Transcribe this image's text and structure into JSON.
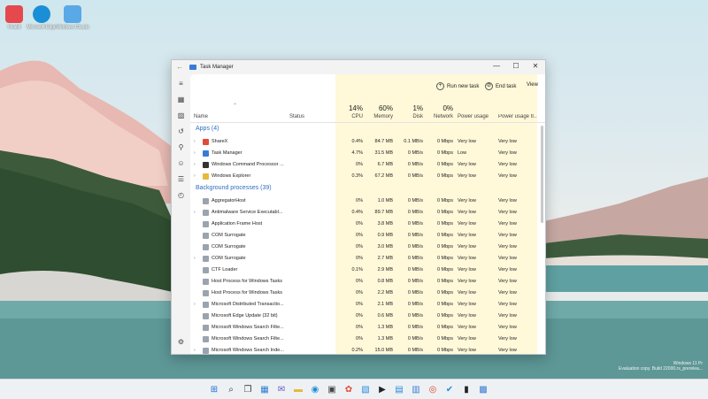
{
  "desktop_icons": [
    {
      "label": "Vivaldi",
      "color": "#e5484d"
    },
    {
      "label": "Microsoft Edge",
      "color": "#1b8fd6"
    },
    {
      "label": "Windows Clouds",
      "color": "#5aa9e6"
    }
  ],
  "watermark": {
    "line1": "Windows 11 Pr",
    "line2": "Evaluation copy. Build 22000.rs_prerelea..."
  },
  "window": {
    "title": "Task Manager",
    "controls": {
      "minimize": "—",
      "maximize": "☐",
      "close": "✕"
    },
    "back": "←"
  },
  "commands": {
    "run_new_task": "Run new task",
    "end_task": "End task",
    "view": "View"
  },
  "columns": {
    "name": "Name",
    "status": "Status",
    "cpu": {
      "label": "CPU",
      "pct": "14%"
    },
    "memory": {
      "label": "Memory",
      "pct": "60%"
    },
    "disk": {
      "label": "Disk",
      "pct": "1%"
    },
    "network": {
      "label": "Network",
      "pct": "0%"
    },
    "power": "Power usage",
    "power_trend": "Power usage tr..."
  },
  "groups": {
    "apps": "Apps (4)",
    "background": "Background processes (39)"
  },
  "apps": [
    {
      "name": "ShareX",
      "cpu": "0.4%",
      "mem": "84.7 MB",
      "disk": "0.1 MB/s",
      "net": "0 Mbps",
      "power": "Very low",
      "trend": "Very low",
      "expand": true,
      "icon_color": "#e04b3c"
    },
    {
      "name": "Task Manager",
      "cpu": "4.7%",
      "mem": "31.5 MB",
      "disk": "0 MB/s",
      "net": "0 Mbps",
      "power": "Low",
      "trend": "Very low",
      "expand": true,
      "icon_color": "#3a7bd5"
    },
    {
      "name": "Windows Command Processor ...",
      "cpu": "0%",
      "mem": "6.7 MB",
      "disk": "0 MB/s",
      "net": "0 Mbps",
      "power": "Very low",
      "trend": "Very low",
      "expand": true,
      "icon_color": "#333333"
    },
    {
      "name": "Windows Explorer",
      "cpu": "0.3%",
      "mem": "67.2 MB",
      "disk": "0 MB/s",
      "net": "0 Mbps",
      "power": "Very low",
      "trend": "Very low",
      "expand": true,
      "icon_color": "#e8b93a"
    }
  ],
  "background": [
    {
      "name": "AggregatorHost",
      "cpu": "0%",
      "mem": "1.0 MB",
      "disk": "0 MB/s",
      "net": "0 Mbps",
      "power": "Very low",
      "trend": "Very low",
      "expand": false
    },
    {
      "name": "Antimalware Service Executabl...",
      "cpu": "0.4%",
      "mem": "89.7 MB",
      "disk": "0 MB/s",
      "net": "0 Mbps",
      "power": "Very low",
      "trend": "Very low",
      "expand": true
    },
    {
      "name": "Application Frame Host",
      "cpu": "0%",
      "mem": "3.8 MB",
      "disk": "0 MB/s",
      "net": "0 Mbps",
      "power": "Very low",
      "trend": "Very low",
      "expand": false
    },
    {
      "name": "COM Surrogate",
      "cpu": "0%",
      "mem": "0.9 MB",
      "disk": "0 MB/s",
      "net": "0 Mbps",
      "power": "Very low",
      "trend": "Very low",
      "expand": false
    },
    {
      "name": "COM Surrogate",
      "cpu": "0%",
      "mem": "3.0 MB",
      "disk": "0 MB/s",
      "net": "0 Mbps",
      "power": "Very low",
      "trend": "Very low",
      "expand": false
    },
    {
      "name": "COM Surrogate",
      "cpu": "0%",
      "mem": "2.7 MB",
      "disk": "0 MB/s",
      "net": "0 Mbps",
      "power": "Very low",
      "trend": "Very low",
      "expand": true
    },
    {
      "name": "CTF Loader",
      "cpu": "0.1%",
      "mem": "2.9 MB",
      "disk": "0 MB/s",
      "net": "0 Mbps",
      "power": "Very low",
      "trend": "Very low",
      "expand": false
    },
    {
      "name": "Host Process for Windows Tasks",
      "cpu": "0%",
      "mem": "0.8 MB",
      "disk": "0 MB/s",
      "net": "0 Mbps",
      "power": "Very low",
      "trend": "Very low",
      "expand": false
    },
    {
      "name": "Host Process for Windows Tasks",
      "cpu": "0%",
      "mem": "2.2 MB",
      "disk": "0 MB/s",
      "net": "0 Mbps",
      "power": "Very low",
      "trend": "Very low",
      "expand": false
    },
    {
      "name": "Microsoft Distributed Transactio...",
      "cpu": "0%",
      "mem": "2.1 MB",
      "disk": "0 MB/s",
      "net": "0 Mbps",
      "power": "Very low",
      "trend": "Very low",
      "expand": true
    },
    {
      "name": "Microsoft Edge Update (32 bit)",
      "cpu": "0%",
      "mem": "0.6 MB",
      "disk": "0 MB/s",
      "net": "0 Mbps",
      "power": "Very low",
      "trend": "Very low",
      "expand": false
    },
    {
      "name": "Microsoft Windows Search Filte...",
      "cpu": "0%",
      "mem": "1.3 MB",
      "disk": "0 MB/s",
      "net": "0 Mbps",
      "power": "Very low",
      "trend": "Very low",
      "expand": false
    },
    {
      "name": "Microsoft Windows Search Filte...",
      "cpu": "0%",
      "mem": "1.3 MB",
      "disk": "0 MB/s",
      "net": "0 Mbps",
      "power": "Very low",
      "trend": "Very low",
      "expand": false
    },
    {
      "name": "Microsoft Windows Search Inde...",
      "cpu": "0.2%",
      "mem": "15.0 MB",
      "disk": "0 MB/s",
      "net": "0 Mbps",
      "power": "Very low",
      "trend": "Very low",
      "expand": true
    }
  ],
  "taskbar": [
    {
      "icon": "windows-start-icon",
      "glyph": "⊞",
      "color": "#1f6fd1"
    },
    {
      "icon": "search-icon",
      "glyph": "⌕",
      "color": "#333"
    },
    {
      "icon": "task-view-icon",
      "glyph": "❐",
      "color": "#333"
    },
    {
      "icon": "widgets-icon",
      "glyph": "▦",
      "color": "#2d7dd2"
    },
    {
      "icon": "chat-icon",
      "glyph": "✉",
      "color": "#6b58c9"
    },
    {
      "icon": "file-explorer-icon",
      "glyph": "▬",
      "color": "#e8b93a"
    },
    {
      "icon": "edge-icon",
      "glyph": "◉",
      "color": "#1b8fd6"
    },
    {
      "icon": "store-icon",
      "glyph": "▣",
      "color": "#444"
    },
    {
      "icon": "sharex-icon",
      "glyph": "✿",
      "color": "#e04b3c"
    },
    {
      "icon": "photos-icon",
      "glyph": "▧",
      "color": "#2a8bd8"
    },
    {
      "icon": "media-icon",
      "glyph": "▶",
      "color": "#222"
    },
    {
      "icon": "notes-icon",
      "glyph": "▤",
      "color": "#2a8bd8"
    },
    {
      "icon": "calendar-icon",
      "glyph": "▥",
      "color": "#3a7bd5"
    },
    {
      "icon": "chrome-icon",
      "glyph": "◎",
      "color": "#db4437"
    },
    {
      "icon": "todo-icon",
      "glyph": "✔",
      "color": "#2a8bd8"
    },
    {
      "icon": "terminal-icon",
      "glyph": "▮",
      "color": "#222"
    },
    {
      "icon": "task-manager-icon",
      "glyph": "▩",
      "color": "#3a7bd5"
    }
  ]
}
